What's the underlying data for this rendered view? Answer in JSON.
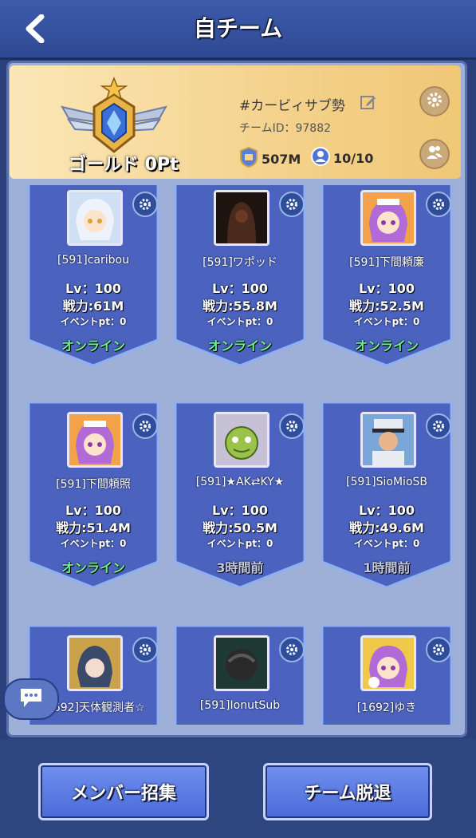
{
  "header": {
    "title": "自チーム"
  },
  "team": {
    "name": "#カービィサブ勢",
    "id_label": "チームID：97882",
    "rank": "ゴールド 0Pt",
    "power": "507M",
    "members": "10/10"
  },
  "members": [
    {
      "name": "[591]caribou",
      "lv": "Lv：100",
      "power": "戦力:61M",
      "event": "イベントpt：0",
      "status": "オンライン",
      "online": true
    },
    {
      "name": "[591]ワポッド",
      "lv": "Lv：100",
      "power": "戦力:55.8M",
      "event": "イベントpt：0",
      "status": "オンライン",
      "online": true
    },
    {
      "name": "[591]下間頼廉",
      "lv": "Lv：100",
      "power": "戦力:52.5M",
      "event": "イベントpt：0",
      "status": "オンライン",
      "online": true
    },
    {
      "name": "[591]下間頼照",
      "lv": "Lv：100",
      "power": "戦力:51.4M",
      "event": "イベントpt：0",
      "status": "オンライン",
      "online": true
    },
    {
      "name": "[591]★AK⇄KY★",
      "lv": "Lv：100",
      "power": "戦力:50.5M",
      "event": "イベントpt：0",
      "status": "3時間前",
      "online": false
    },
    {
      "name": "[591]SioMioSB",
      "lv": "Lv：100",
      "power": "戦力:49.6M",
      "event": "イベントpt：0",
      "status": "1時間前",
      "online": false
    },
    {
      "name": "[1692]天体観測者☆",
      "lv": "",
      "power": "",
      "event": "",
      "status": "",
      "online": false
    },
    {
      "name": "[591]IonutSub",
      "lv": "",
      "power": "",
      "event": "",
      "status": "",
      "online": false
    },
    {
      "name": "[1692]ゆき",
      "lv": "",
      "power": "",
      "event": "",
      "status": "",
      "online": false
    }
  ],
  "buttons": {
    "recruit": "メンバー招集",
    "leave": "チーム脱退"
  },
  "colors": {
    "online": "#6df08a",
    "panel": "#9fb0d8",
    "card": "#4b62bf",
    "header_card": "#f4d28c"
  }
}
